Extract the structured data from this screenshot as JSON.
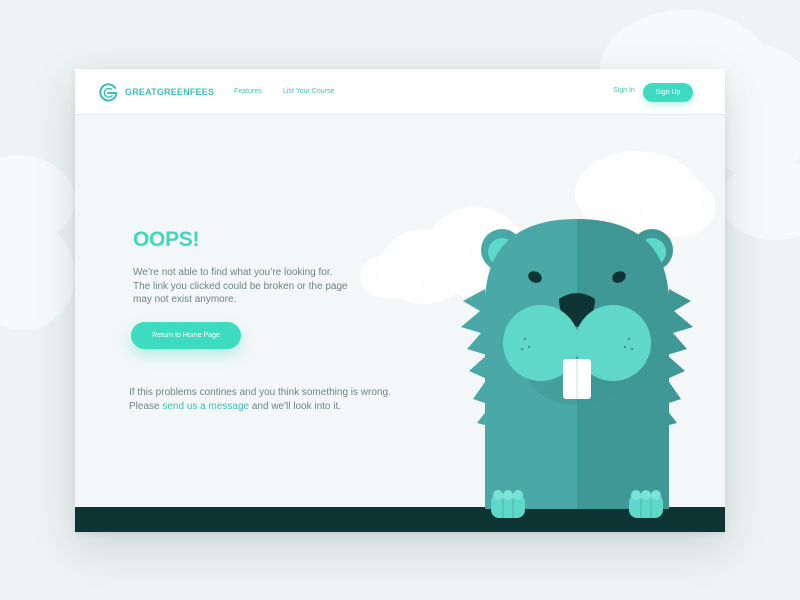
{
  "header": {
    "brand": "GREATGREENFEES",
    "nav": [
      "Features",
      "List Your Course"
    ],
    "sign_in": "Sign In",
    "sign_up": "Sign Up",
    "logo_icon": "g-logo-icon"
  },
  "error": {
    "title": "OOPS!",
    "lines": [
      "We’re not able to find what you’re looking for.",
      "The link you clicked could be broken or the page",
      "may not exist anymore."
    ],
    "button": "Return to Home Page",
    "help_line1": "If this problems contines and you think something is wrong.",
    "help_prefix": "Please ",
    "help_link": "send us a message",
    "help_suffix": " and we'll look into it."
  },
  "illustration": {
    "name": "beaver-mascot"
  },
  "colors": {
    "accent": "#3ddbbf",
    "brand_text": "#3fbfb4",
    "beaver_body": "#4aa9a6",
    "beaver_dark": "#3f9896",
    "beaver_light": "#5fd8ca",
    "ground": "#0f3434",
    "body_text": "#6f8484",
    "background": "#eef3f3"
  }
}
